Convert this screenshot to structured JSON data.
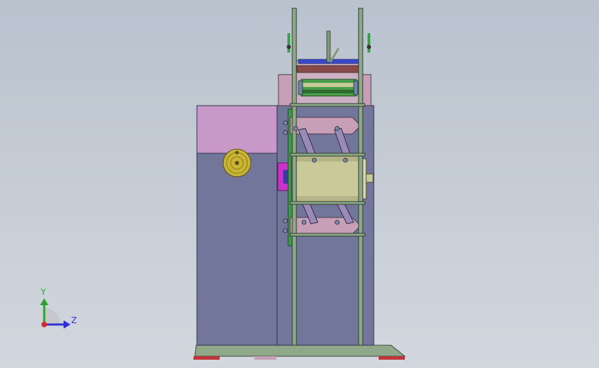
{
  "viewport": {
    "background_top": "#b9c2ce",
    "background_bottom": "#d2d7de"
  },
  "triad": {
    "y_label": "Y",
    "z_label": "Z",
    "y_color": "#2aa32a",
    "z_color": "#2f2fd8",
    "x_color": "#d42a2a"
  },
  "colors": {
    "cabinet": "#72769a",
    "panel_pink": "#c899c8",
    "frame_green": "#8ea98a",
    "base_green": "#8fa88a",
    "roller_olive": "#c9c99a",
    "knob_yellow": "#c9b532",
    "foot_red": "#c0363a",
    "magenta": "#c832c8",
    "link_lavender": "#9a8ab6"
  }
}
